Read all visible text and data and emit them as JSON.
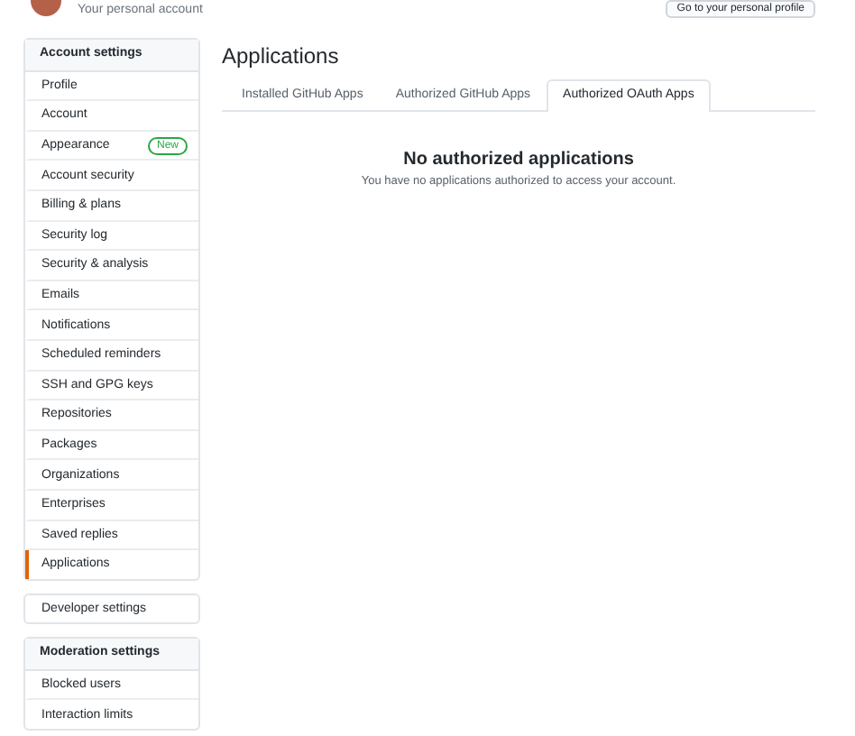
{
  "header": {
    "subtitle": "Your personal account",
    "profile_button": "Go to your personal profile"
  },
  "sidebar": {
    "sections": [
      {
        "title": "Account settings",
        "items": [
          {
            "label": "Profile",
            "selected": false
          },
          {
            "label": "Account",
            "selected": false
          },
          {
            "label": "Appearance",
            "selected": false,
            "badge": "New"
          },
          {
            "label": "Account security",
            "selected": false
          },
          {
            "label": "Billing & plans",
            "selected": false
          },
          {
            "label": "Security log",
            "selected": false
          },
          {
            "label": "Security & analysis",
            "selected": false
          },
          {
            "label": "Emails",
            "selected": false
          },
          {
            "label": "Notifications",
            "selected": false
          },
          {
            "label": "Scheduled reminders",
            "selected": false
          },
          {
            "label": "SSH and GPG keys",
            "selected": false
          },
          {
            "label": "Repositories",
            "selected": false
          },
          {
            "label": "Packages",
            "selected": false
          },
          {
            "label": "Organizations",
            "selected": false
          },
          {
            "label": "Enterprises",
            "selected": false
          },
          {
            "label": "Saved replies",
            "selected": false
          },
          {
            "label": "Applications",
            "selected": true
          }
        ]
      },
      {
        "items": [
          {
            "label": "Developer settings",
            "selected": false
          }
        ]
      },
      {
        "title": "Moderation settings",
        "items": [
          {
            "label": "Blocked users",
            "selected": false
          },
          {
            "label": "Interaction limits",
            "selected": false
          }
        ]
      }
    ]
  },
  "main": {
    "title": "Applications",
    "tabs": [
      {
        "label": "Installed GitHub Apps",
        "selected": false
      },
      {
        "label": "Authorized GitHub Apps",
        "selected": false
      },
      {
        "label": "Authorized OAuth Apps",
        "selected": true
      }
    ],
    "empty_state": {
      "heading": "No authorized applications",
      "text": "You have no applications authorized to access your account."
    }
  }
}
